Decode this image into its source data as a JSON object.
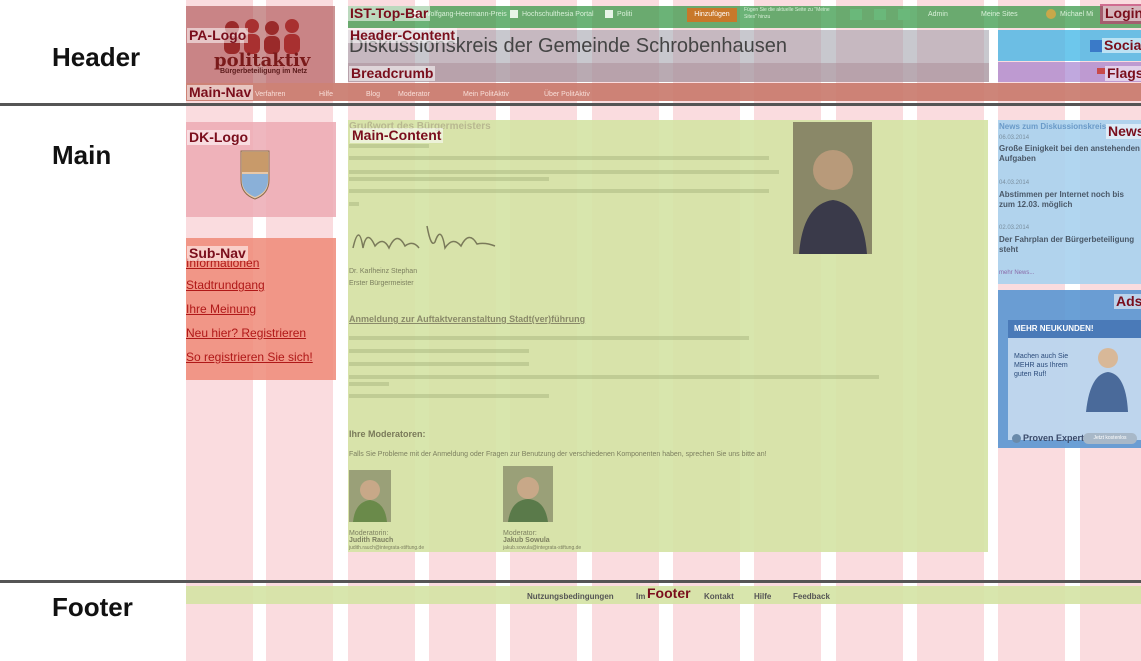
{
  "section_labels": {
    "header": "Header",
    "main": "Main",
    "footer": "Footer"
  },
  "region_tags": {
    "ist_top_bar": "IST-Top-Bar",
    "pa_logo": "PA-Logo",
    "header_content": "Header-Content",
    "breadcrumb": "Breadcrumb",
    "main_nav": "Main-Nav",
    "login": "Login",
    "social": "Social",
    "flags": "Flags",
    "dk_logo": "DK-Logo",
    "main_content": "Main-Content",
    "news": "News",
    "ads": "Ads",
    "sub_nav": "Sub-Nav",
    "footer": "Footer"
  },
  "site": {
    "logo_text": "politaktiv",
    "logo_subtitle": "Bürgerbeteiligung im Netz",
    "title_fragment": "Diskussionskreis der Gemeinde Schrobenhausen"
  },
  "top_bar": {
    "items": [
      "Wolfgang-Heermann-Preis",
      "Hochschulthesia Portal",
      "Politi"
    ],
    "add_button": "Hinzufügen",
    "add_hint": "Fügen Sie die aktuelle Seite zu \"Meine Sites\" hinzu",
    "admin": "Admin",
    "my_sites": "Meine Sites",
    "user": "Michael Mi"
  },
  "main_nav": {
    "items": [
      "Verfahren",
      "Hilfe",
      "Blog",
      "Moderator",
      "Mein PolitAktiv",
      "Über PolitAktiv"
    ]
  },
  "sub_nav": {
    "items": [
      "Informationen",
      "Stadtrundgang",
      "Ihre Meinung",
      "Neu hier? Registrieren",
      "So registrieren Sie sich!"
    ]
  },
  "main_content": {
    "heading1": "Grußwort des Bürgermeisters",
    "signature_name": "Dr. Karlheinz Stephan",
    "signature_role": "Erster Bürgermeister",
    "heading2": "Anmeldung zur Auftaktveranstaltung Stadt(ver)führung",
    "heading3": "Ihre Moderatoren:",
    "moderators_intro": "Falls Sie Probleme mit der Anmeldung oder Fragen zur Benutzung der verschiedenen Komponenten haben, sprechen Sie uns bitte an!",
    "moderator1_role": "Moderatorin:",
    "moderator1_name": "Judith Rauch",
    "moderator1_mail": "judith.rauch@integrata-stiftung.de",
    "moderator2_role": "Moderator:",
    "moderator2_name": "Jakub Sowula",
    "moderator2_mail": "jakub.sowula@integrata-stiftung.de"
  },
  "news": {
    "header": "News zum Diskussionskreis",
    "items": [
      {
        "date": "06.03.2014",
        "title": "Große Einigkeit bei den anstehenden Aufgaben"
      },
      {
        "date": "04.03.2014",
        "title": "Abstimmen per Internet noch bis zum 12.03. möglich"
      },
      {
        "date": "02.03.2014",
        "title": "Der Fahrplan der Bürgerbeteiligung steht"
      }
    ],
    "more": "mehr News..."
  },
  "ad": {
    "headline": "MEHR NEUKUNDEN!",
    "body": "Machen auch Sie MEHR aus Ihrem guten Ruf!",
    "brand": "Proven Expert",
    "cta": "Jetzt kostenlos"
  },
  "footer": {
    "items": [
      "Nutzungsbedingungen",
      "Im",
      "Kontakt",
      "Hilfe",
      "Feedback"
    ]
  },
  "colors": {
    "column": "#f4b2b8",
    "main_content": "#d4e3a4",
    "news": "#a9d2ee",
    "sub_nav": "#ef8a78",
    "nav_bar": "#c8786a",
    "top_bar": "#3a9a4a",
    "tag_text": "#7a0e1c"
  }
}
